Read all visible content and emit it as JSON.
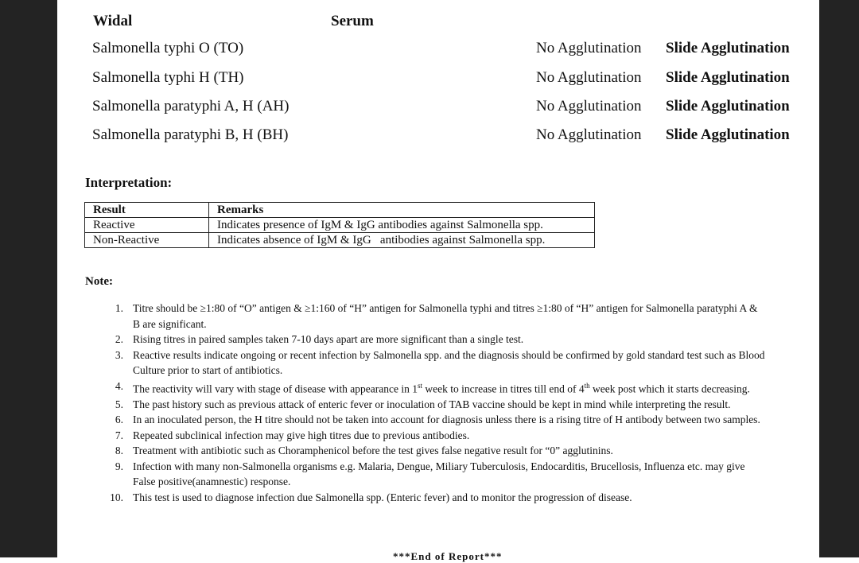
{
  "widal": {
    "title": "Widal",
    "specimen": "Serum",
    "rows": [
      {
        "test": "Salmonella typhi O (TO)",
        "result": "No Agglutination",
        "method": "Slide Agglutination"
      },
      {
        "test": "Salmonella typhi H (TH)",
        "result": "No Agglutination",
        "method": "Slide Agglutination"
      },
      {
        "test": "Salmonella paratyphi A, H (AH)",
        "result": "No Agglutination",
        "method": "Slide Agglutination"
      },
      {
        "test": "Salmonella paratyphi B, H (BH)",
        "result": "No Agglutination",
        "method": "Slide Agglutination"
      }
    ]
  },
  "interpretation": {
    "title": "Interpretation:",
    "headers": [
      "Result",
      "Remarks"
    ],
    "rows": [
      {
        "result": "Reactive",
        "remarks": "Indicates presence of IgM & IgG antibodies against Salmonella spp."
      },
      {
        "result": "Non-Reactive",
        "remarks": "Indicates absence of IgM & IgG   antibodies against Salmonella spp."
      }
    ]
  },
  "notes": {
    "title": "Note:",
    "items": [
      {
        "num": "1.",
        "text": "Titre should be ≥1:80 of “O” antigen & ≥1:160 of “H” antigen for Salmonella typhi and titres ≥1:80 of “H” antigen for Salmonella paratyphi A & B are significant."
      },
      {
        "num": "2.",
        "text": "Rising titres in paired samples taken 7-10 days apart are more significant than a single test."
      },
      {
        "num": "3.",
        "text": "Reactive results indicate ongoing or recent infection by Salmonella spp. and the diagnosis should be confirmed by gold standard test such as Blood Culture prior to start of antibiotics."
      },
      {
        "num": "4.",
        "text_before": "The reactivity will vary with stage of disease with appearance in 1",
        "sup1": "st",
        "text_mid": " week to increase in titres till end of 4",
        "sup2": "th",
        "text_after": " week post which it starts decreasing."
      },
      {
        "num": "5.",
        "text": "The past history such as previous attack of enteric fever or inoculation of TAB vaccine should be kept in mind while interpreting the result."
      },
      {
        "num": "6.",
        "text": "In an inoculated person, the H titre should not be taken into account for diagnosis unless there is a rising titre of H antibody between two samples."
      },
      {
        "num": "7.",
        "text": "Repeated subclinical infection may give high titres due to previous antibodies."
      },
      {
        "num": "8.",
        "text": "Treatment with antibiotic such as Choramphenicol before the test gives false negative result for “0” agglutinins."
      },
      {
        "num": "9.",
        "text": "Infection with many non-Salmonella organisms e.g. Malaria, Dengue, Miliary Tuberculosis, Endocarditis, Brucellosis, Influenza etc. may give False positive(anamnestic) response."
      },
      {
        "num": "10.",
        "text": "This test is used to diagnose infection due Salmonella spp. (Enteric fever) and to monitor the progression of disease."
      }
    ]
  },
  "end_text": "***End of Report***"
}
